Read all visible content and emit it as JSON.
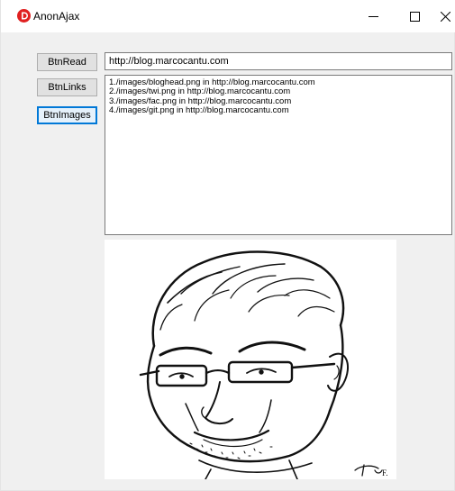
{
  "window": {
    "title": "AnonAjax",
    "accent": "#e02020"
  },
  "buttons": {
    "read": "BtnRead",
    "links": "BtnLinks",
    "images": "BtnImages"
  },
  "url_input": {
    "value": "http://blog.marcocantu.com"
  },
  "memo": {
    "lines": [
      "1./images/bloghead.png in http://blog.marcocantu.com",
      "2./images/twi.png in http://blog.marcocantu.com",
      "3./images/fac.png in http://blog.marcocantu.com",
      "4./images/git.png in http://blog.marcocantu.com"
    ]
  },
  "image": {
    "description_icon": "caricature-image",
    "signature": "F."
  }
}
